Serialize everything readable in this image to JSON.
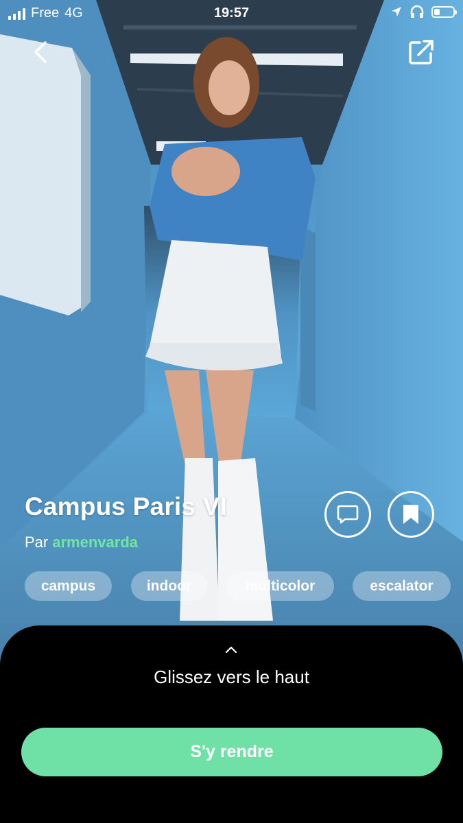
{
  "status_bar": {
    "carrier": "Free",
    "network": "4G",
    "time": "19:57",
    "battery_level": 0.3
  },
  "nav": {
    "back_icon": "chevron-left-icon",
    "share_icon": "share-external-icon"
  },
  "place": {
    "title": "Campus Paris VI",
    "author_prefix": "Par",
    "author_name": "armenvarda"
  },
  "actions": {
    "comment_icon": "comment-icon",
    "bookmark_icon": "bookmark-icon"
  },
  "tags": [
    "campus",
    "indoor",
    "multicolor",
    "escalator"
  ],
  "sheet": {
    "hint": "Glissez vers le haut",
    "button_label": "S'y rendre"
  },
  "colors": {
    "accent": "#6fe0a6",
    "author": "#6fe6a6",
    "sheet_bg": "#000000"
  }
}
